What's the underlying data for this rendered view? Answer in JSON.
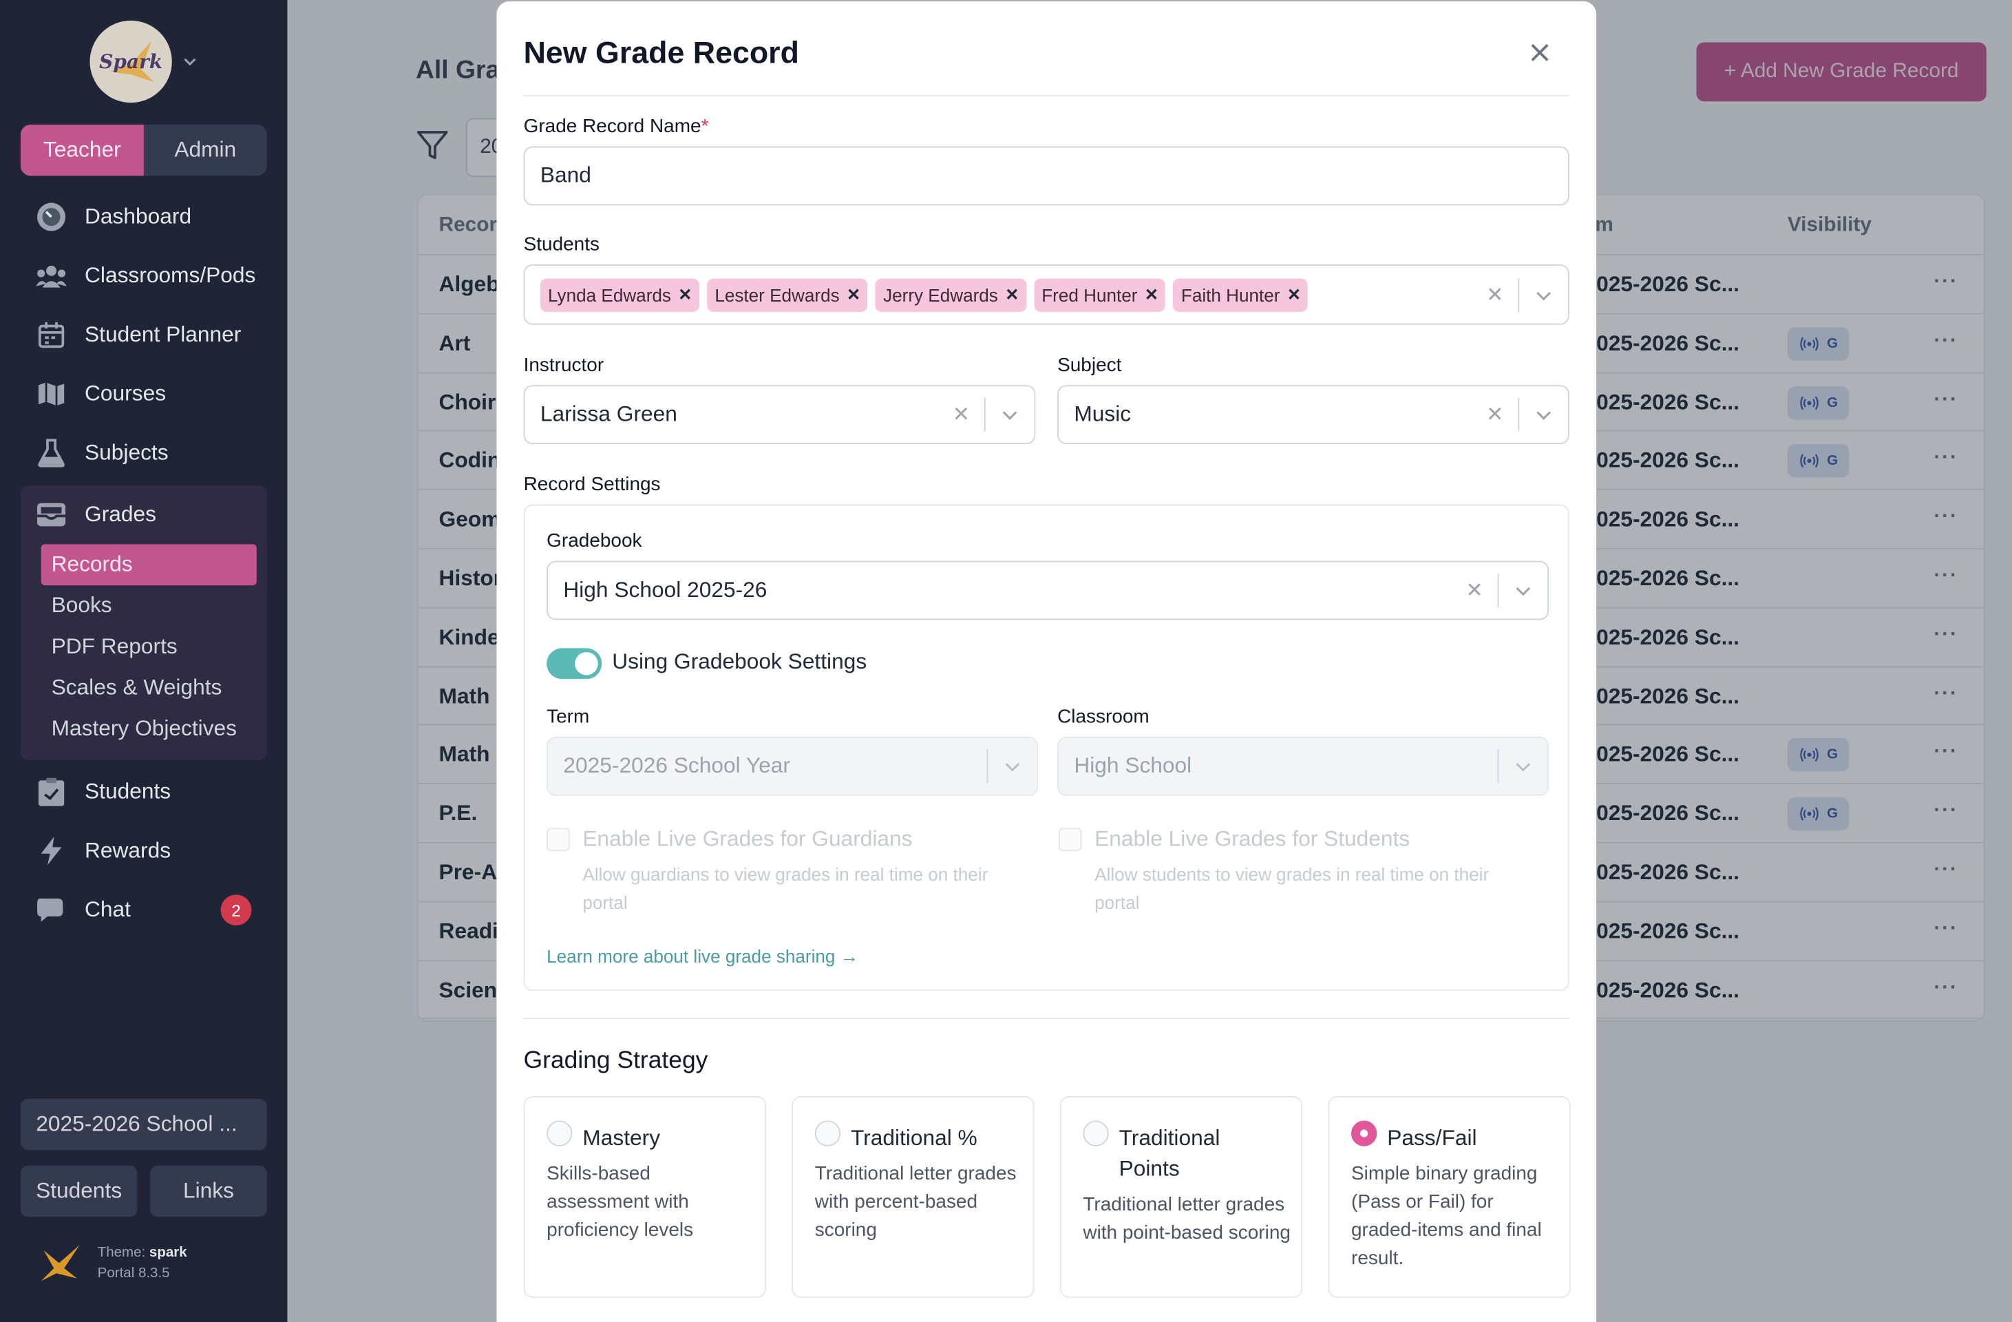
{
  "sidebar": {
    "logo_text": "Spark",
    "roles": [
      "Teacher",
      "Admin"
    ],
    "active_role": "Teacher",
    "nav": [
      {
        "label": "Dashboard",
        "icon": "dashboard-icon"
      },
      {
        "label": "Classrooms/Pods",
        "icon": "users-icon"
      },
      {
        "label": "Student Planner",
        "icon": "calendar-icon"
      },
      {
        "label": "Courses",
        "icon": "map-icon"
      },
      {
        "label": "Subjects",
        "icon": "flask-icon"
      },
      {
        "label": "Grades",
        "icon": "inbox-icon"
      }
    ],
    "grades_sub": [
      "Records",
      "Books",
      "PDF Reports",
      "Scales & Weights",
      "Mastery Objectives"
    ],
    "nav_after": [
      {
        "label": "Students",
        "icon": "clipboard-icon"
      },
      {
        "label": "Rewards",
        "icon": "bolt-icon"
      },
      {
        "label": "Chat",
        "icon": "chat-icon",
        "badge": "2"
      }
    ],
    "term_selector": "2025-2026 School ...",
    "bottom_buttons": [
      "Students",
      "Links"
    ],
    "theme_label": "Theme:",
    "theme_name": "spark",
    "portal_version": "Portal 8.3.5"
  },
  "background_page": {
    "title": "All Gra",
    "add_button": "+ Add New Grade Record",
    "term_filter": "20",
    "columns": {
      "record": "Recor",
      "term": "erm",
      "visibility": "Visibility"
    },
    "rows": [
      {
        "name": "Algeb",
        "term": "025-2026 Sc...",
        "visibility": false
      },
      {
        "name": "Art",
        "term": "025-2026 Sc...",
        "visibility": true
      },
      {
        "name": "Choir",
        "term": "025-2026 Sc...",
        "visibility": true
      },
      {
        "name": "Codin",
        "term": "025-2026 Sc...",
        "visibility": true
      },
      {
        "name": "Geom",
        "term": "025-2026 Sc...",
        "visibility": false
      },
      {
        "name": "Histor",
        "term": "025-2026 Sc...",
        "visibility": false
      },
      {
        "name": "Kinde",
        "term": "025-2026 Sc...",
        "visibility": false
      },
      {
        "name": "Math",
        "term": "025-2026 Sc...",
        "visibility": false
      },
      {
        "name": "Math",
        "term": "025-2026 Sc...",
        "visibility": true
      },
      {
        "name": "P.E.",
        "term": "025-2026 Sc...",
        "visibility": true
      },
      {
        "name": "Pre-A",
        "term": "025-2026 Sc...",
        "visibility": false
      },
      {
        "name": "Readi",
        "term": "025-2026 Sc...",
        "visibility": false
      },
      {
        "name": "Scien",
        "term": "025-2026 Sc...",
        "visibility": false
      }
    ],
    "visibility_badge_letter": "G",
    "more_glyph": "···"
  },
  "modal": {
    "title": "New Grade Record",
    "name_label": "Grade Record Name",
    "name_required": "*",
    "name_value": "Band",
    "students_label": "Students",
    "students": [
      "Lynda Edwards",
      "Lester Edwards",
      "Jerry Edwards",
      "Fred Hunter",
      "Faith Hunter"
    ],
    "instructor_label": "Instructor",
    "instructor_value": "Larissa Green",
    "subject_label": "Subject",
    "subject_value": "Music",
    "record_settings_label": "Record Settings",
    "gradebook_label": "Gradebook",
    "gradebook_value": "High School 2025-26",
    "use_gradebook_settings_label": "Using Gradebook Settings",
    "use_gradebook_settings_on": true,
    "term_label": "Term",
    "term_value": "2025-2026 School Year",
    "classroom_label": "Classroom",
    "classroom_value": "High School",
    "live_guardians_title": "Enable Live Grades for Guardians",
    "live_guardians_desc": "Allow guardians to view grades in real time on their portal",
    "live_students_title": "Enable Live Grades for Students",
    "live_students_desc": "Allow students to view grades in real time on their portal",
    "learn_more": "Learn more about live grade sharing →",
    "grading_strategy_title": "Grading Strategy",
    "strategies": [
      {
        "title": "Mastery",
        "desc": "Skills-based assessment with proficiency levels",
        "selected": false
      },
      {
        "title": "Traditional %",
        "desc": "Traditional letter grades with percent-based scoring",
        "selected": false
      },
      {
        "title": "Traditional Points",
        "desc": "Traditional letter grades with point-based scoring",
        "selected": false
      },
      {
        "title": "Pass/Fail",
        "desc": "Simple binary grading (Pass or Fail) for graded-items and final result.",
        "selected": true
      }
    ]
  },
  "colors": {
    "sidebar_bg": "#1f2536",
    "accent_pink": "#c2568f",
    "toggle_teal": "#5bbab6",
    "chip_pink": "#f5c6dc",
    "chat_badge": "#d23a4e"
  }
}
